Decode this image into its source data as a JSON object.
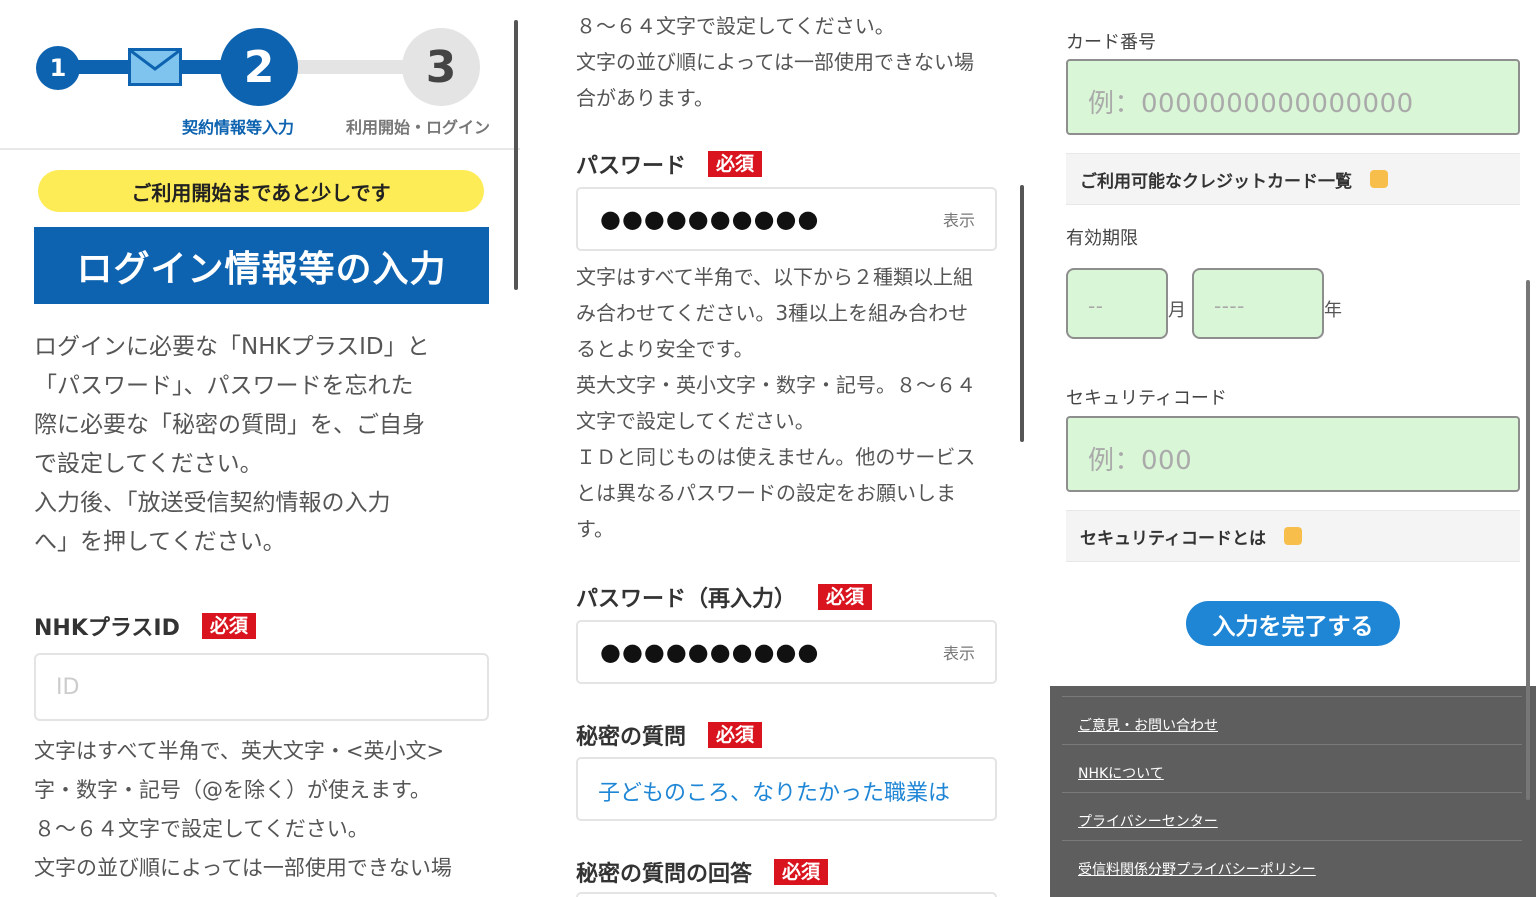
{
  "stepper": {
    "steps": [
      {
        "number": "1",
        "label": ""
      },
      {
        "number": "2",
        "label": "契約情報等入力"
      },
      {
        "number": "3",
        "label": "利用開始・ログイン"
      }
    ]
  },
  "panel1": {
    "banner": "ご利用開始まであと少しです",
    "title": "ログイン情報等の入力",
    "intro": [
      "ログインに必要な「NHKプラスID」と",
      "「パスワード」、パスワードを忘れた",
      "際に必要な「秘密の質問」を、ご自身",
      "で設定してください。",
      "入力後、「放送受信契約情報の入力",
      "へ」を押してください。"
    ],
    "id_label": "NHKプラスID",
    "required": "必須",
    "id_placeholder": "ID",
    "id_help": [
      "文字はすべて半角で、英大文字・<英小文>",
      "字・数字・記号（@を除く）が使えます。",
      "８～６４文字で設定してください。",
      "文字の並び順によっては一部使用できない場"
    ]
  },
  "panel2": {
    "top_help": [
      "８～６４文字で設定してください。",
      "文字の並び順によっては一部使用できない場",
      "合があります。"
    ],
    "password_label": "パスワード",
    "required": "必須",
    "password_value": "●●●●●●●●●●",
    "show_label": "表示",
    "password_help": [
      "文字はすべて半角で、以下から２種類以上組",
      "み合わせてください。3種以上を組み合わせ",
      "るとより安全です。",
      "英大文字・英小文字・数字・記号。８～６４",
      "文字で設定してください。",
      "ＩＤと同じものは使えません。他のサービス",
      "とは異なるパスワードの設定をお願いしま",
      "す。"
    ],
    "password_confirm_label": "パスワード（再入力）",
    "password_confirm_value": "●●●●●●●●●●",
    "secret_question_label": "秘密の質問",
    "secret_question_value": "子どものころ、なりたかった職業は",
    "secret_answer_label": "秘密の質問の回答"
  },
  "panel3": {
    "card_number_label": "カード番号",
    "card_number_placeholder": "例：0000000000000000",
    "card_list_link": "ご利用可能なクレジットカード一覧",
    "expiry_label": "有効期限",
    "month_placeholder": "--",
    "month_unit": "月",
    "year_placeholder": "----",
    "year_unit": "年",
    "security_label": "セキュリティコード",
    "security_placeholder": "例：000",
    "security_info_link": "セキュリティコードとは",
    "submit_label": "入力を完了する",
    "footer_links": [
      "ご意見・お問い合わせ",
      "NHKについて",
      "プライバシーセンター",
      "受信料関係分野プライバシーポリシー"
    ]
  },
  "colors": {
    "brand_blue": "#0d63b0",
    "button_blue": "#1f86d6",
    "required_red": "#d9141e",
    "banner_yellow": "#fdec55",
    "input_green": "#d9f6d6",
    "footer_gray": "#5e5e5e"
  }
}
